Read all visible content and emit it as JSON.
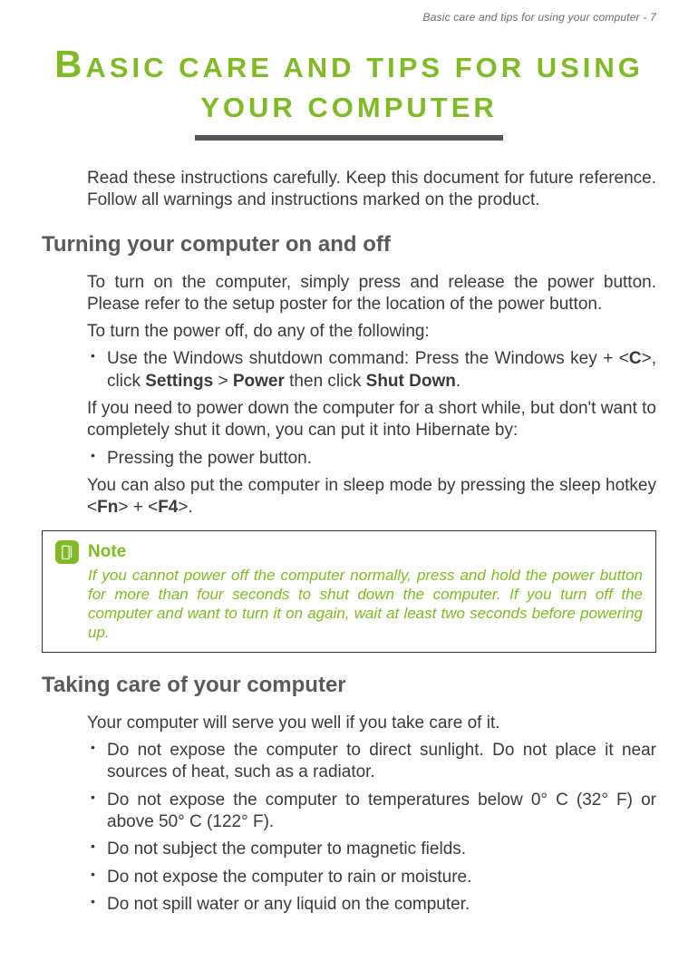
{
  "header": "Basic care and tips for using your computer - 7",
  "title_line1_cap": "B",
  "title_line1_rest": "ASIC CARE AND TIPS FOR USING",
  "title_line2": "YOUR COMPUTER",
  "intro": "Read these instructions carefully. Keep this document for future reference. Follow all warnings and instructions marked on the product.",
  "h2_on_off": "Turning your computer on and off",
  "p_turn_on": "To turn on the computer, simply press and release the power button. Please refer to the setup poster for the location of the power button.",
  "p_turn_off": "To turn the power off, do any of the following:",
  "li_shutdown_pre": "Use the Windows shutdown command: Press the Windows key + <",
  "li_shutdown_c": "C",
  "li_shutdown_mid1": ">, click ",
  "li_shutdown_settings": "Settings",
  "li_shutdown_gt1": " > ",
  "li_shutdown_power": "Power",
  "li_shutdown_then": " then click ",
  "li_shutdown_sd": "Shut Down",
  "li_shutdown_dot": ".",
  "p_hibernate": "If you need to power down the computer for a short while, but don't want to completely shut it down, you can put it into Hibernate by:",
  "li_press_pwr": "Pressing the power button.",
  "p_sleep_pre": "You can also put the computer in sleep mode by pressing the sleep hotkey <",
  "p_sleep_fn": "Fn",
  "p_sleep_mid": "> + <",
  "p_sleep_f4": "F4",
  "p_sleep_end": ">.",
  "note_label": "Note",
  "note_body": "If you cannot power off the computer normally, press and hold the power button for more than four seconds to shut down the computer. If you turn off the computer and want to turn it on again, wait at least two seconds before powering up.",
  "h2_care": "Taking care of your computer",
  "p_care_intro": "Your computer will serve you well if you take care of it.",
  "li_sun": "Do not expose the computer to direct sunlight. Do not place it near sources of heat, such as a radiator.",
  "li_temp": "Do not expose the computer to temperatures below 0° C (32° F) or above 50° C (122° F).",
  "li_mag": "Do not subject the computer to magnetic fields.",
  "li_rain": "Do not expose the computer to rain or moisture.",
  "li_spill": "Do not spill water or any liquid on the computer."
}
